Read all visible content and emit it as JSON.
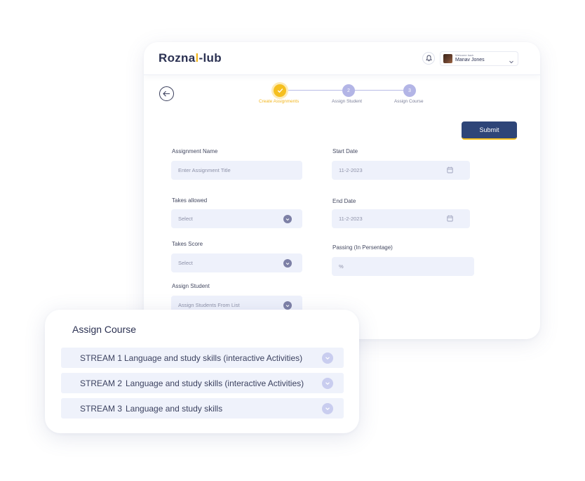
{
  "app": {
    "logo_main": "Rozna",
    "logo_accent": "l",
    "logo_end": "-lub",
    "welcome_text": "Welcome back",
    "user_name": "Manav Jones"
  },
  "stepper": {
    "steps": [
      {
        "label": "Create Assignments",
        "number": "",
        "status": "active"
      },
      {
        "label": "Assign Student",
        "number": "2",
        "status": "pending"
      },
      {
        "label": "Assign Course",
        "number": "3",
        "status": "pending"
      }
    ]
  },
  "form": {
    "submit_label": "Submit",
    "assignment_name": {
      "label": "Assignment Name",
      "placeholder": "Enter Assignment Title"
    },
    "start_date": {
      "label": "Start Date",
      "value": "11-2-2023"
    },
    "takes_allowed": {
      "label": "Takes allowed",
      "value": "Select"
    },
    "end_date": {
      "label": "End Date",
      "value": "11-2-2023"
    },
    "takes_score": {
      "label": "Takes Score",
      "value": "Select"
    },
    "passing": {
      "label": "Passing (In Persentage)",
      "value": "%"
    },
    "assign_student": {
      "label": "Assign Student",
      "value": "Assign Students From List"
    }
  },
  "assign_course": {
    "title": "Assign Course",
    "streams": [
      {
        "code": "STREAM 1",
        "name": "Language and study skills (interactive Activities)"
      },
      {
        "code": "STREAM 2",
        "name": "Language and study skills (interactive Activities)"
      },
      {
        "code": "STREAM 3",
        "name": "Language and study skills"
      }
    ]
  },
  "colors": {
    "primary": "#2e4578",
    "accent": "#f5bf1f",
    "step_pending": "#b3b5e6",
    "input_bg": "#eef1fb"
  }
}
